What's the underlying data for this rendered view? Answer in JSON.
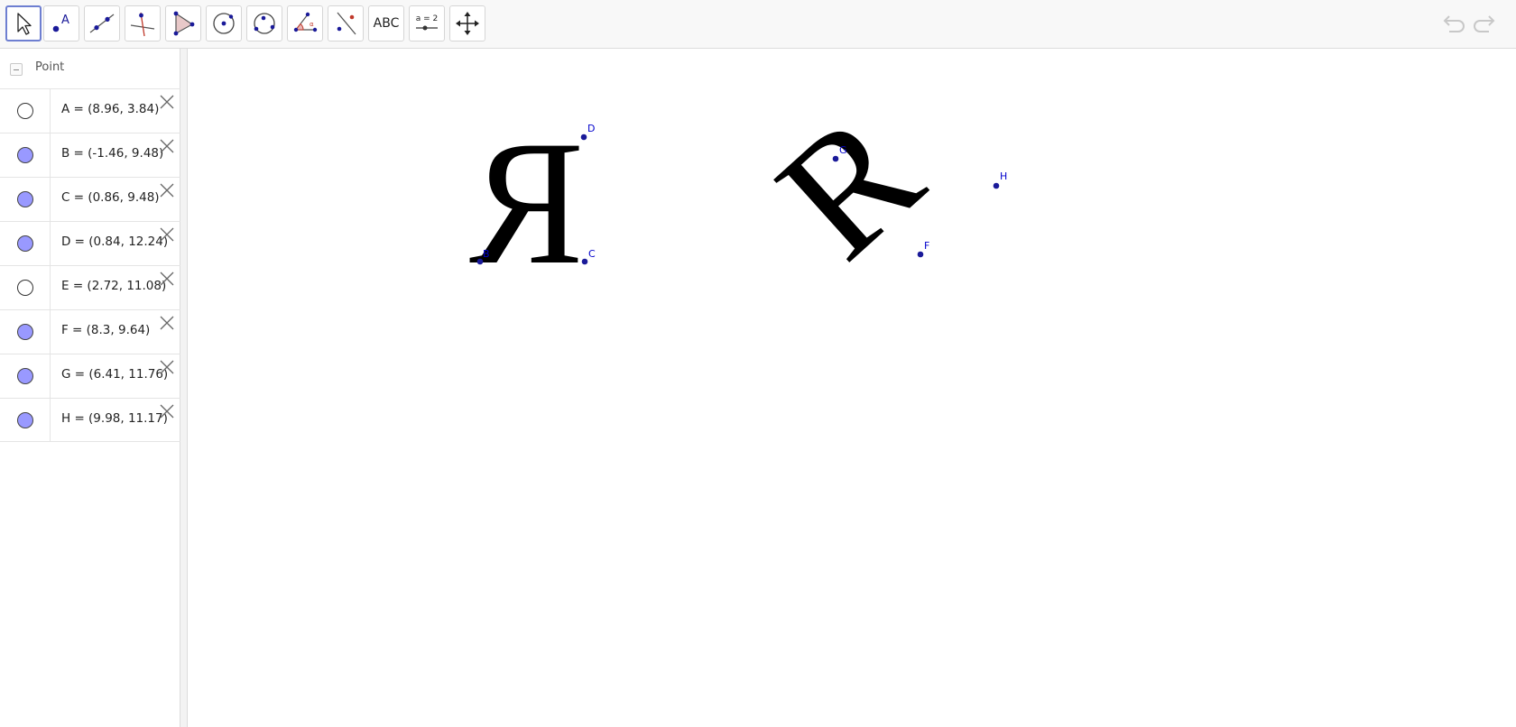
{
  "toolbar": {
    "tools": [
      {
        "name": "move-tool",
        "label": ""
      },
      {
        "name": "point-tool",
        "label": ""
      },
      {
        "name": "line-tool",
        "label": ""
      },
      {
        "name": "perpendicular-line-tool",
        "label": ""
      },
      {
        "name": "polygon-tool",
        "label": ""
      },
      {
        "name": "circle-center-point-tool",
        "label": ""
      },
      {
        "name": "circle-three-points-tool",
        "label": ""
      },
      {
        "name": "angle-tool",
        "label": ""
      },
      {
        "name": "reflect-about-line-tool",
        "label": ""
      },
      {
        "name": "text-tool",
        "label": "ABC"
      },
      {
        "name": "slider-tool",
        "label": "a = 2"
      },
      {
        "name": "move-graphics-view-tool",
        "label": ""
      }
    ],
    "selected_tool": "move-tool",
    "icons": {
      "undo": "undo-icon",
      "redo": "redo-icon"
    }
  },
  "algebra": {
    "group_label": "Point",
    "rows": [
      {
        "text": "A = (8.96, 3.84)",
        "visible": false
      },
      {
        "text": "B = (-1.46, 9.48)",
        "visible": true
      },
      {
        "text": "C = (0.86, 9.48)",
        "visible": true
      },
      {
        "text": "D = (0.84, 12.24)",
        "visible": true
      },
      {
        "text": "E = (2.72, 11.08)",
        "visible": false
      },
      {
        "text": "F = (8.3, 9.64)",
        "visible": true
      },
      {
        "text": "G = (6.41, 11.76)",
        "visible": true
      },
      {
        "text": "H = (9.98, 11.17)",
        "visible": true
      }
    ]
  },
  "graphics": {
    "point_labels": {
      "B": "B",
      "C": "C",
      "D": "D",
      "F": "F",
      "G": "G",
      "H": "H"
    },
    "colors": {
      "point": "#1a1a99",
      "label": "#0000cc",
      "image": "#000000",
      "marble_on": "#9999ff"
    }
  }
}
